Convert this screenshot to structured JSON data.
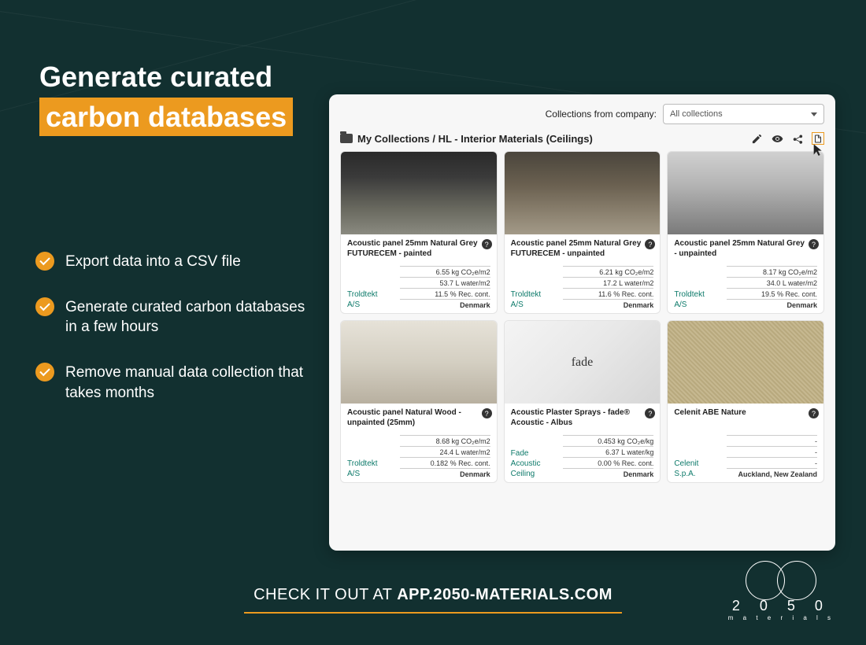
{
  "headline": {
    "line1": "Generate curated",
    "line2": "carbon databases"
  },
  "bullets": [
    "Export data into a CSV file",
    "Generate curated carbon databases in a few hours",
    "Remove manual data collection that takes months"
  ],
  "footer": {
    "prefix": "CHECK IT OUT AT ",
    "link": "APP.2050-MATERIALS.COM"
  },
  "logo": {
    "main": "2 0 5 0",
    "sub": "m a t e r i a l s"
  },
  "app": {
    "filter_label": "Collections from company:",
    "filter_value": "All collections",
    "breadcrumb": "My Collections / HL - Interior Materials (Ceilings)",
    "cards": [
      {
        "title": "Acoustic panel 25mm Natural Grey FUTURECEM - painted",
        "mfr": "Troldtekt",
        "mfr2": "A/S",
        "m1": "6.55 kg CO₂e/m2",
        "m2": "53.7 L water/m2",
        "m3": "11.5 % Rec. cont.",
        "loc": "Denmark",
        "thumb": "t1"
      },
      {
        "title": "Acoustic panel 25mm Natural Grey FUTURECEM - unpainted",
        "mfr": "Troldtekt",
        "mfr2": "A/S",
        "m1": "6.21 kg CO₂e/m2",
        "m2": "17.2 L water/m2",
        "m3": "11.6 % Rec. cont.",
        "loc": "Denmark",
        "thumb": "t2"
      },
      {
        "title": "Acoustic panel 25mm Natural Grey - unpainted",
        "mfr": "Troldtekt",
        "mfr2": "A/S",
        "m1": "8.17 kg CO₂e/m2",
        "m2": "34.0 L water/m2",
        "m3": "19.5 % Rec. cont.",
        "loc": "Denmark",
        "thumb": "t3"
      },
      {
        "title": "Acoustic panel Natural Wood - unpainted (25mm)",
        "mfr": "Troldtekt",
        "mfr2": "A/S",
        "m1": "8.68 kg CO₂e/m2",
        "m2": "24.4 L water/m2",
        "m3": "0.182 % Rec. cont.",
        "loc": "Denmark",
        "thumb": "t4"
      },
      {
        "title": "Acoustic Plaster Sprays - fade® Acoustic - Albus",
        "mfr": "Fade",
        "mfr2": "Acoustic",
        "mfr3": "Ceiling",
        "m1": "0.453 kg CO₂e/kg",
        "m2": "6.37 L water/kg",
        "m3": "0.00 % Rec. cont.",
        "loc": "Denmark",
        "thumb": "t5"
      },
      {
        "title": "Celenit ABE Nature",
        "mfr": "Celenit",
        "mfr2": "S.p.A.",
        "m1": "-",
        "m2": "-",
        "m3": "-",
        "loc": "Auckland, New Zealand",
        "thumb": "t6"
      }
    ]
  }
}
